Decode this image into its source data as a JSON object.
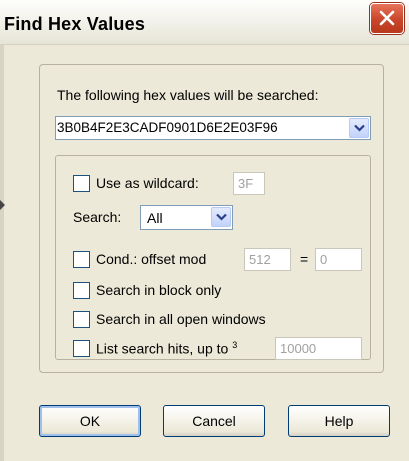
{
  "window": {
    "title": "Find Hex Values"
  },
  "search": {
    "prompt": "The following hex values will be searched:",
    "hex_value": "3B0B4F2E3CADF0901D6E2E03F96"
  },
  "options": {
    "wildcard_label": "Use as wildcard:",
    "wildcard_value": "3F",
    "search_label": "Search:",
    "search_selected": "All",
    "cond_label": "Cond.: offset mod",
    "cond_mod_value": "512",
    "cond_equals": "=",
    "cond_remainder_value": "0",
    "block_only_label": "Search in block only",
    "all_windows_label": "Search in all open windows",
    "list_hits_label": "List search hits, up to",
    "list_hits_superscript": "3",
    "list_hits_value": "10000"
  },
  "buttons": {
    "ok": "OK",
    "cancel": "Cancel",
    "help": "Help"
  }
}
